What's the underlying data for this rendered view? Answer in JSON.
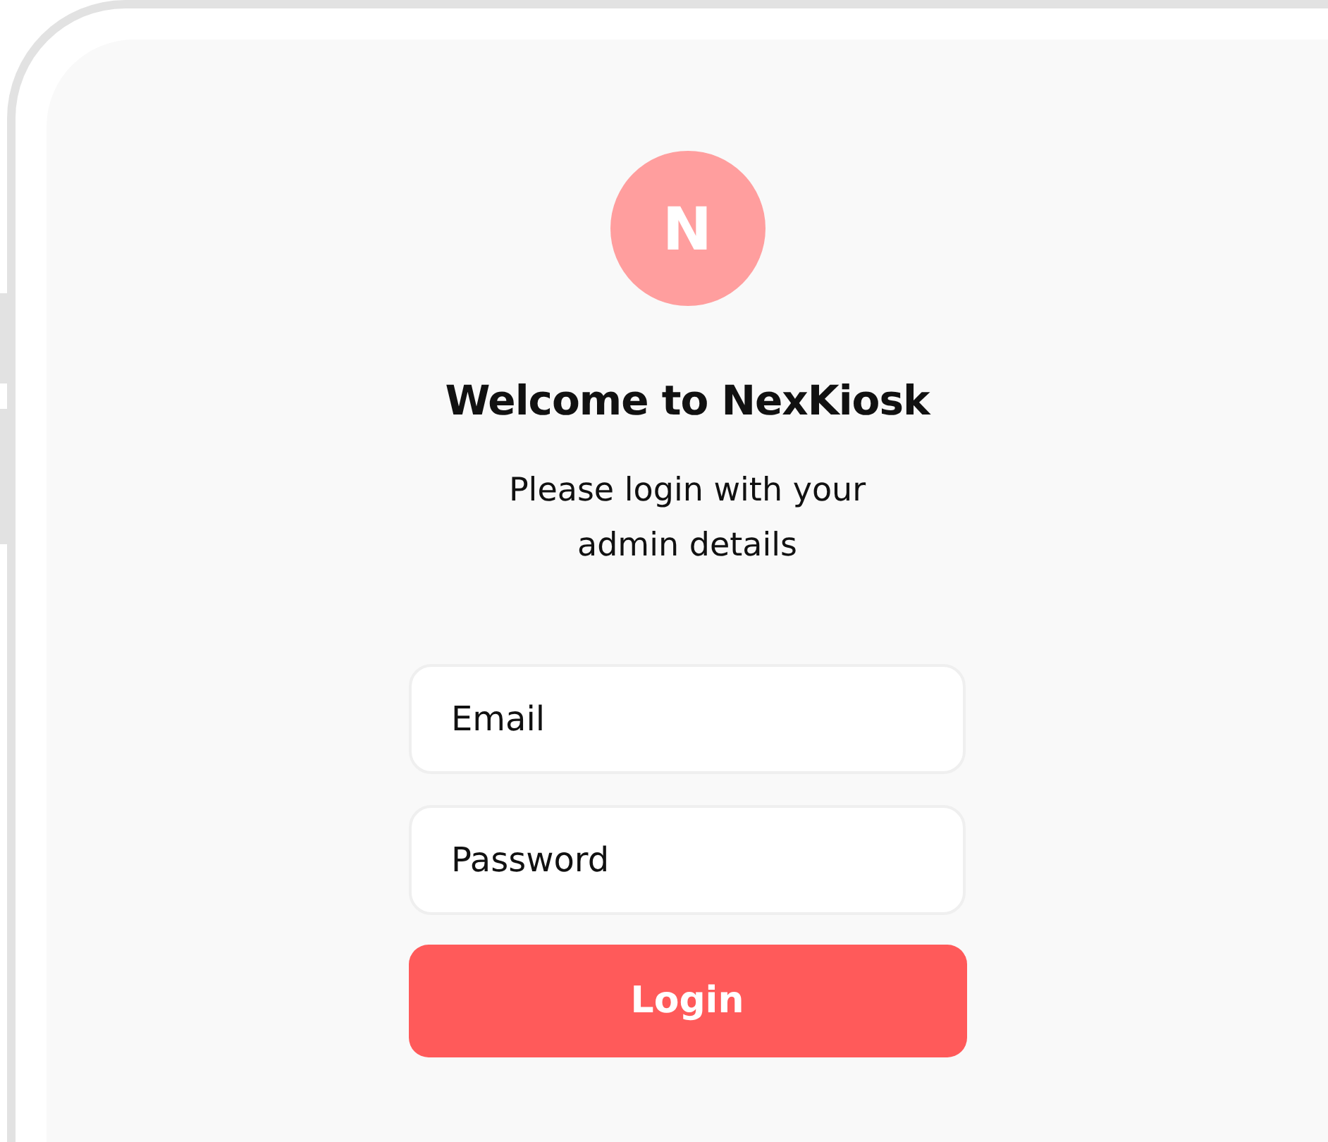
{
  "logo": {
    "letter": "N"
  },
  "title": "Welcome to NexKiosk",
  "subtitle": "Please login with your admin details",
  "fields": [
    {
      "placeholder": "Email"
    },
    {
      "placeholder": "Password"
    }
  ],
  "button": "Login"
}
